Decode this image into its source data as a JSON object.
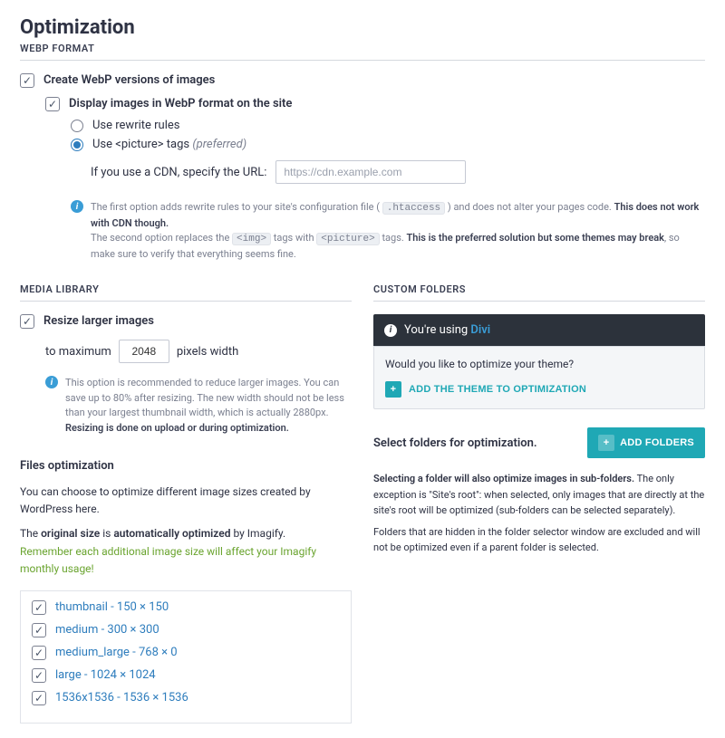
{
  "page": {
    "title": "Optimization"
  },
  "webp": {
    "section": "WEBP FORMAT",
    "create_label": "Create WebP versions of images",
    "display_label": "Display images in WebP format on the site",
    "radio_rewrite": "Use rewrite rules",
    "radio_picture_prefix": "Use ",
    "radio_picture_code": "<picture>",
    "radio_picture_suffix": " tags ",
    "radio_picture_pref": "(preferred)",
    "cdn_label": "If you use a CDN, specify the URL:",
    "cdn_placeholder": "https://cdn.example.com",
    "help_a": "The first option adds rewrite rules to your site's configuration file ( ",
    "help_code1": ".htaccess",
    "help_b": " ) and does not alter your pages code. ",
    "help_bold1": "This does not work with CDN though.",
    "help_c": "The second option replaces the ",
    "help_code2": "<img>",
    "help_d": " tags with ",
    "help_code3": "<picture>",
    "help_e": " tags. ",
    "help_bold2": "This is the preferred solution but some themes may break",
    "help_f": ", so make sure to verify that everything seems fine."
  },
  "media": {
    "section": "MEDIA LIBRARY",
    "resize_label": "Resize larger images",
    "to_max": "to maximum",
    "width_value": "2048",
    "px_label": "pixels width",
    "help_a": "This option is recommended to reduce larger images. You can save up to 80% after resizing. The new width should not be less than your largest thumbnail width, which is actually 2880px. ",
    "help_bold": "Resizing is done on upload or during optimization."
  },
  "files": {
    "title": "Files optimization",
    "p1": "You can choose to optimize different image sizes created by WordPress here.",
    "p2a": "The ",
    "p2b": "original size",
    "p2c": " is ",
    "p2d": "automatically optimized",
    "p2e": " by Imagify.",
    "p3": "Remember each additional image size will affect your Imagify monthly usage!",
    "sizes": [
      "thumbnail - 150 × 150",
      "medium - 300 × 300",
      "medium_large - 768 × 0",
      "large - 1024 × 1024",
      "1536x1536 - 1536 × 1536"
    ]
  },
  "custom": {
    "section": "CUSTOM FOLDERS",
    "using": "You're using ",
    "theme": "Divi",
    "panel_q": "Would you like to optimize your theme?",
    "add_theme": "ADD THE THEME TO OPTIMIZATION",
    "select_label": "Select folders for optimization.",
    "add_folders": "ADD FOLDERS",
    "desc_bold": "Selecting a folder will also optimize images in sub-folders.",
    "desc_a": " The only exception is \"Site's root\": when selected, only images that are directly at the site's root will be optimized (sub-folders can be selected separately).",
    "desc_b": "Folders that are hidden in the folder selector window are excluded and will not be optimized even if a parent folder is selected."
  }
}
